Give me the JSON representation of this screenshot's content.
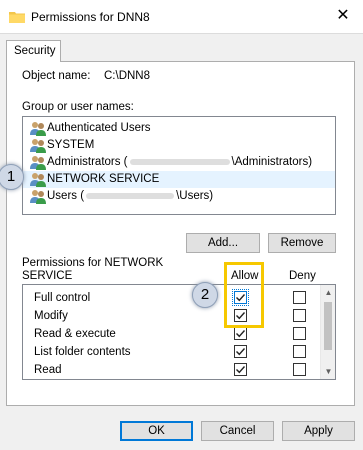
{
  "window": {
    "title": "Permissions for DNN8",
    "close_glyph": "✕"
  },
  "tabs": [
    {
      "label": "Security"
    }
  ],
  "object": {
    "label": "Object name:",
    "value": "C:\\DNN8"
  },
  "group_label": "Group or user names:",
  "users": [
    {
      "name": "Authenticated Users",
      "suffix": ""
    },
    {
      "name": "SYSTEM",
      "suffix": ""
    },
    {
      "name": "Administrators (",
      "suffix": "\\Administrators)"
    },
    {
      "name": "NETWORK SERVICE",
      "suffix": ""
    },
    {
      "name": "Users (",
      "suffix": "\\Users)"
    }
  ],
  "selected_user_index": 3,
  "buttons": {
    "add": "Add...",
    "remove": "Remove",
    "ok": "OK",
    "cancel": "Cancel",
    "apply": "Apply"
  },
  "permissions_header": {
    "line1": "Permissions for NETWORK",
    "line2": "SERVICE",
    "allow": "Allow",
    "deny": "Deny"
  },
  "permissions": [
    {
      "name": "Full control",
      "allow": true,
      "deny": false
    },
    {
      "name": "Modify",
      "allow": true,
      "deny": false
    },
    {
      "name": "Read & execute",
      "allow": true,
      "deny": false
    },
    {
      "name": "List folder contents",
      "allow": true,
      "deny": false
    },
    {
      "name": "Read",
      "allow": true,
      "deny": false
    }
  ],
  "callouts": [
    {
      "label": "1"
    },
    {
      "label": "2"
    }
  ],
  "colors": {
    "accent": "#0078d7",
    "highlight": "#f6c800",
    "selected_row": "#e5f3ff"
  },
  "icons": {
    "folder": "folder-icon",
    "user": "user-group-icon",
    "close": "close-icon",
    "check": "checkmark-icon"
  }
}
